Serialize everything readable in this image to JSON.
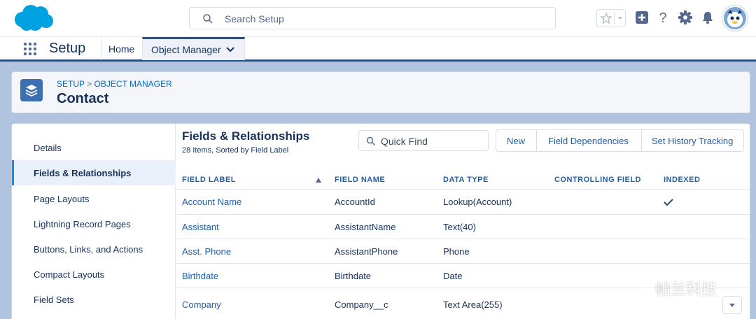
{
  "header": {
    "search_placeholder": "Search Setup",
    "icons": [
      "salesforce-cloud-logo",
      "favorites-star-icon",
      "add-icon",
      "help-icon",
      "setup-gear-icon",
      "notifications-bell-icon",
      "user-avatar"
    ]
  },
  "nav": {
    "app_name": "Setup",
    "tabs": [
      {
        "label": "Home"
      },
      {
        "label": "Object Manager",
        "active": true
      }
    ]
  },
  "page_header": {
    "breadcrumb_setup": "SETUP",
    "breadcrumb_sep": " > ",
    "breadcrumb_om": "OBJECT MANAGER",
    "title": "Contact"
  },
  "sidebar": {
    "items": [
      {
        "label": "Details"
      },
      {
        "label": "Fields & Relationships",
        "active": true
      },
      {
        "label": "Page Layouts"
      },
      {
        "label": "Lightning Record Pages"
      },
      {
        "label": "Buttons, Links, and Actions"
      },
      {
        "label": "Compact Layouts"
      },
      {
        "label": "Field Sets"
      }
    ]
  },
  "fields": {
    "title": "Fields & Relationships",
    "subtitle": "28 Items, Sorted by Field Label",
    "quick_find_placeholder": "Quick Find",
    "buttons": [
      "New",
      "Field Dependencies",
      "Set History Tracking"
    ],
    "columns": [
      "FIELD LABEL",
      "FIELD NAME",
      "DATA TYPE",
      "CONTROLLING FIELD",
      "INDEXED"
    ],
    "rows": [
      {
        "label": "Account Name",
        "name": "AccountId",
        "type": "Lookup(Account)",
        "controlling": "",
        "indexed": true
      },
      {
        "label": "Assistant",
        "name": "AssistantName",
        "type": "Text(40)",
        "controlling": "",
        "indexed": false
      },
      {
        "label": "Asst. Phone",
        "name": "AssistantPhone",
        "type": "Phone",
        "controlling": "",
        "indexed": false
      },
      {
        "label": "Birthdate",
        "name": "Birthdate",
        "type": "Date",
        "controlling": "",
        "indexed": false
      },
      {
        "label": "Company",
        "name": "Company__c",
        "type": "Text Area(255)",
        "controlling": "",
        "indexed": false
      }
    ]
  },
  "watermark": {
    "text": "帕兰科技"
  },
  "colors": {
    "brand_blue": "#00a1e0",
    "link_blue": "#1e5faa",
    "title_navy": "#16325c",
    "nav_accent": "#1b5297"
  }
}
